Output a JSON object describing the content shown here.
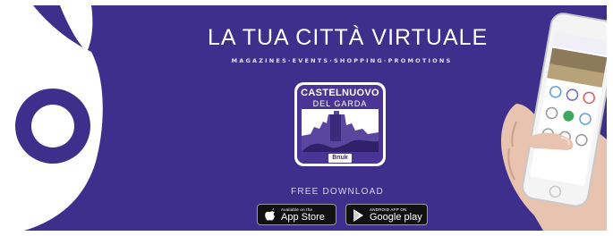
{
  "colors": {
    "background": "#3f2f8c",
    "accent_text": "#ffffff",
    "icon_purple": "#4a3596"
  },
  "banner": {
    "headline": "LA TUA CITTÀ VIRTUALE",
    "tagline": "MAGAZINES·EVENTS·SHOPPING·PROMOTIONS",
    "free_download": "FREE DOWNLOAD"
  },
  "app_icon": {
    "title": "CASTELNUOVO",
    "subtitle": "DEL GARDA",
    "brand": "Bnuk"
  },
  "stores": {
    "apple": {
      "small": "Available on the",
      "big": "App Store",
      "icon": "apple-icon"
    },
    "google": {
      "small": "ANDROID APP ON",
      "big": "Google play",
      "icon": "play-icon"
    }
  },
  "decor": {
    "left_mascot": "owl-mascot-icon",
    "phone": "phone-mockup"
  }
}
